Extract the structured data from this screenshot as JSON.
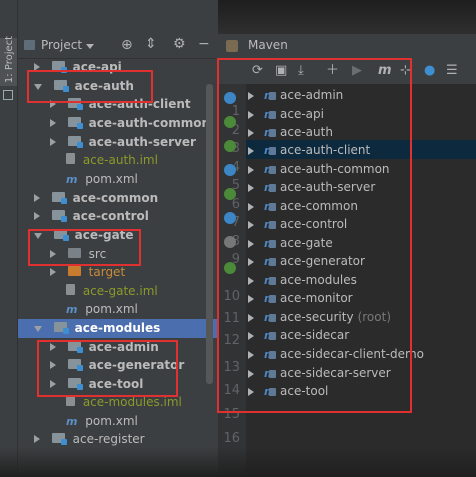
{
  "left_strip": {
    "tab_label": "1: Project"
  },
  "project_panel": {
    "title": "Project",
    "tree": [
      {
        "label": "ace-api",
        "bold": true,
        "depth": 0,
        "expanded": false
      },
      {
        "label": "ace-auth",
        "bold": true,
        "depth": 0,
        "expanded": true
      },
      {
        "label": "ace-auth-client",
        "bold": true,
        "depth": 1,
        "expanded": false
      },
      {
        "label": "ace-auth-common",
        "bold": true,
        "depth": 1,
        "expanded": false
      },
      {
        "label": "ace-auth-server",
        "bold": true,
        "depth": 1,
        "expanded": false
      },
      {
        "label": "ace-auth.iml",
        "depth": 1,
        "kind": "iml"
      },
      {
        "label": "pom.xml",
        "depth": 1,
        "kind": "pom"
      },
      {
        "label": "ace-common",
        "bold": true,
        "depth": 0,
        "expanded": false
      },
      {
        "label": "ace-control",
        "bold": true,
        "depth": 0,
        "expanded": false
      },
      {
        "label": "ace-gate",
        "bold": true,
        "depth": 0,
        "expanded": true
      },
      {
        "label": "src",
        "depth": 1,
        "expanded": false,
        "kind": "folder"
      },
      {
        "label": "target",
        "depth": 1,
        "expanded": false,
        "kind": "target"
      },
      {
        "label": "ace-gate.iml",
        "depth": 1,
        "kind": "iml"
      },
      {
        "label": "pom.xml",
        "depth": 1,
        "kind": "pom"
      },
      {
        "label": "ace-modules",
        "bold": true,
        "depth": 0,
        "expanded": true,
        "selected": true
      },
      {
        "label": "ace-admin",
        "bold": true,
        "depth": 1,
        "expanded": false
      },
      {
        "label": "ace-generator",
        "bold": true,
        "depth": 1,
        "expanded": false
      },
      {
        "label": "ace-tool",
        "bold": true,
        "depth": 1,
        "expanded": false
      },
      {
        "label": "ace-modules.iml",
        "depth": 1,
        "kind": "iml"
      },
      {
        "label": "pom.xml",
        "depth": 1,
        "kind": "pom"
      },
      {
        "label": "ace-register",
        "bold": false,
        "depth": 0,
        "expanded": false
      }
    ]
  },
  "editor": {
    "line_numbers": [
      "1",
      "2",
      "3",
      "4",
      "5",
      "6",
      "7",
      "8",
      "9",
      "10",
      "11",
      "12",
      "13",
      "14",
      "15",
      "16"
    ]
  },
  "maven_panel": {
    "title": "Maven",
    "projects": [
      {
        "label": "ace-admin"
      },
      {
        "label": "ace-api"
      },
      {
        "label": "ace-auth"
      },
      {
        "label": "ace-auth-client",
        "selected": true
      },
      {
        "label": "ace-auth-common"
      },
      {
        "label": "ace-auth-server"
      },
      {
        "label": "ace-common"
      },
      {
        "label": "ace-control"
      },
      {
        "label": "ace-gate"
      },
      {
        "label": "ace-generator"
      },
      {
        "label": "ace-modules"
      },
      {
        "label": "ace-monitor"
      },
      {
        "label": "ace-security",
        "note": "(root)"
      },
      {
        "label": "ace-sidecar"
      },
      {
        "label": "ace-sidecar-client-demo"
      },
      {
        "label": "ace-sidecar-server"
      },
      {
        "label": "ace-tool"
      }
    ]
  },
  "colors": {
    "annotation_red": "#e0302f",
    "selection_blue": "#4b6eaf",
    "maven_selection": "#0d293e"
  }
}
